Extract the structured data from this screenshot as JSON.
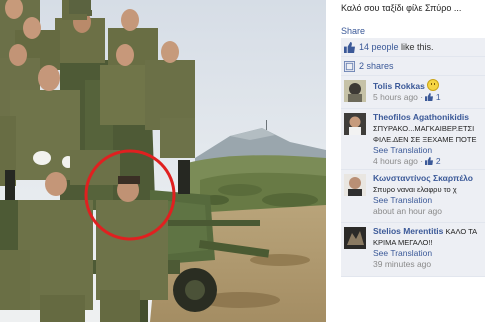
{
  "post": {
    "caption": "Καλό σου ταξίδι φίλε Σπύρο ...",
    "share_label": "Share"
  },
  "likes": {
    "count_text": "14 people",
    "suffix": " like this.",
    "icon": "thumbs-up-icon"
  },
  "shares": {
    "text": "2 shares",
    "icon": "share-icon"
  },
  "comments": [
    {
      "author": "Tolis Rokkas",
      "text": "",
      "translate": "",
      "time": "5 hours ago",
      "likes": "1",
      "emoticon": "smiley-icon"
    },
    {
      "author": "Theofilos Agathonikidis",
      "text": "ΣΠΥΡΑΚΟ...ΜΑΓΚΑΙΒΕΡ.ΕΤΣΙ",
      "text2": "ΦΙΛΕ.ΔΕΝ ΣΕ ΞΕΧΑΜΕ ΠΟΤΕ",
      "translate": "See Translation",
      "time": "4 hours ago",
      "likes": "2"
    },
    {
      "author": "Κωνσταντίνος Σκαρπέλο",
      "text": "Σπυρο ναναι ελαφρυ το χ",
      "translate": "See Translation",
      "time": "about an hour ago",
      "likes": ""
    },
    {
      "author": "Stelios Merentitis",
      "author_suffix": " ΚΑΛΟ ΤΑ",
      "text": "ΚΡΙΜΑ ΜΕΓΑΛΟ!!",
      "translate": "See Translation",
      "time": "39 minutes ago",
      "likes": ""
    }
  ],
  "colors": {
    "link": "#3b5998",
    "panel": "#edeff4",
    "highlight_circle": "#e02020"
  }
}
